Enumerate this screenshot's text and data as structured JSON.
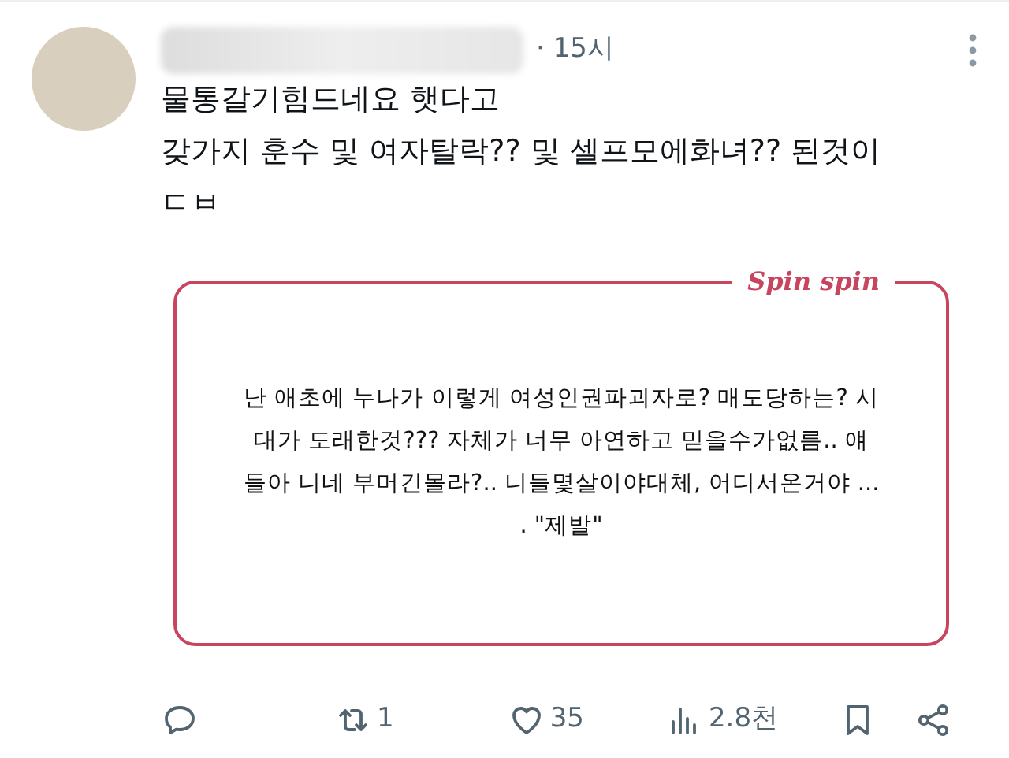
{
  "post": {
    "time": "· 15시",
    "text_lines": [
      "물통갈기힘드네요 햇다고",
      "갖가지 훈수 및 여자탈락?? 및 셀프모에화녀?? 된것이",
      "ㄷㅂ"
    ],
    "image": {
      "logo": "Spin spin",
      "lines": [
        "난 애초에 누나가 이렇게 여성인권파괴자로? 매도당하는? 시",
        "대가 도래한것??? 자체가 너무 아연하고 믿을수가없름.. 얘",
        "들아 니네 부머긴몰라?.. 니들몇살이야대체, 어디서온거야 ...",
        ". \"제발\""
      ]
    },
    "actions": [
      {
        "kind": "reply"
      },
      {
        "kind": "repost",
        "count": "1"
      },
      {
        "kind": "like",
        "count": "35"
      },
      {
        "kind": "views",
        "count": "2.8천"
      },
      {
        "kind": "bookmark"
      },
      {
        "kind": "share"
      }
    ]
  }
}
